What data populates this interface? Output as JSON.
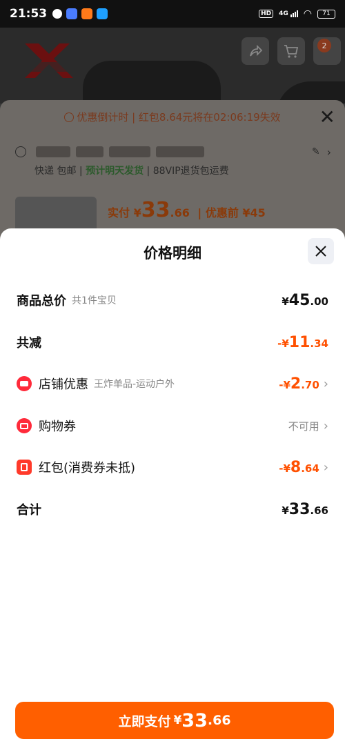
{
  "status_bar": {
    "time": "21:53",
    "network": "4G",
    "battery": "71"
  },
  "background": {
    "countdown_text": "优惠倒计时 | 红包8.64元将在02:06:19失效",
    "shipping": {
      "method": "快递 包邮",
      "delivery": "预计明天发货",
      "return": "88VIP退货包运费"
    },
    "price_line": {
      "label": "实付",
      "yen": "¥",
      "int": "33",
      "dec": ".66",
      "before": "| 优惠前 ¥45"
    },
    "cart_badge": "2"
  },
  "modal": {
    "title": "价格明细",
    "rows": [
      {
        "label": "商品总价",
        "sub": "共1件宝贝",
        "amount": {
          "prefix": "¥",
          "int": "45",
          "dec": ".00"
        }
      },
      {
        "label": "共减",
        "amount": {
          "prefix": "-¥",
          "int": "11",
          "dec": ".34"
        }
      },
      {
        "label": "店铺优惠",
        "sub": "王炸单品-运动户外",
        "amount": {
          "prefix": "-¥",
          "int": "2",
          "dec": ".70"
        }
      },
      {
        "label": "购物券",
        "value_text": "不可用"
      },
      {
        "label": "红包(消费券未抵)",
        "amount": {
          "prefix": "-¥",
          "int": "8",
          "dec": ".64"
        }
      },
      {
        "label": "合计",
        "amount": {
          "prefix": "¥",
          "int": "33",
          "dec": ".66"
        }
      }
    ]
  },
  "pay_button": {
    "label": "立即支付",
    "yen": "¥",
    "int": "33",
    "dec": ".66"
  },
  "colors": {
    "accent": "#ff5000",
    "button": "#ff5f00",
    "icon_red": "#ff2a3a"
  }
}
